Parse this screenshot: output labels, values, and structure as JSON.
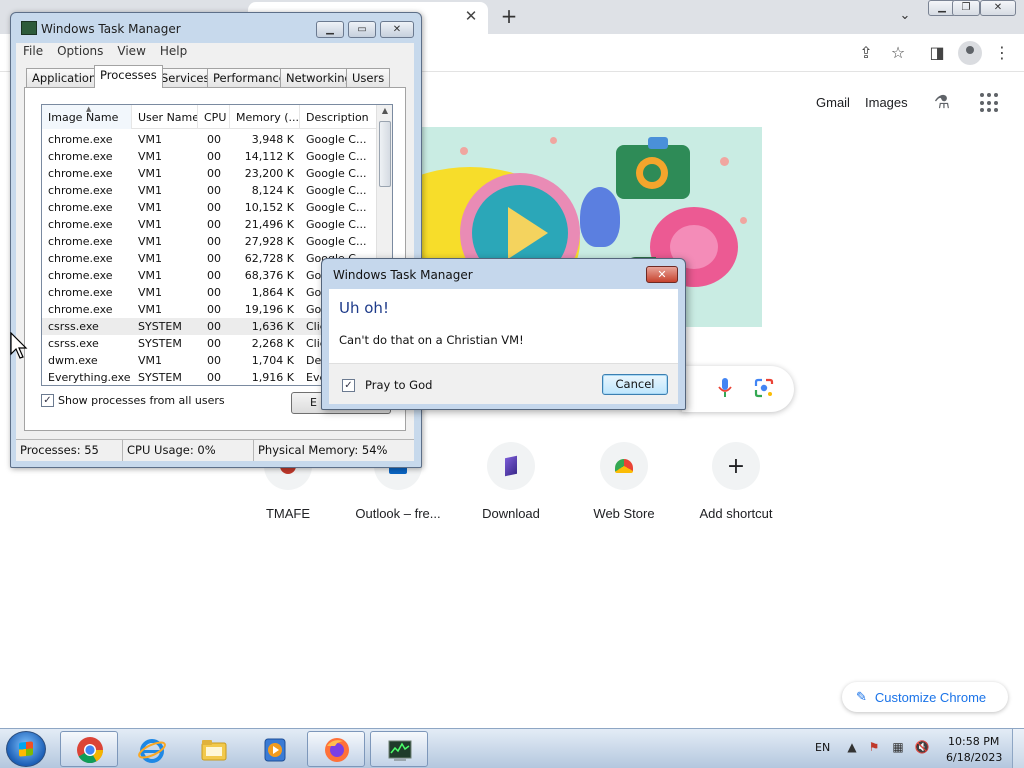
{
  "chrome": {
    "top_links": [
      "Gmail",
      "Images"
    ],
    "shortcuts": [
      {
        "label": "TMAFE",
        "icon": "tmafe-icon"
      },
      {
        "label": "Outlook – fre...",
        "icon": "outlook-icon"
      },
      {
        "label": "Download",
        "icon": "download-site-icon"
      },
      {
        "label": "Web Store",
        "icon": "chrome-web-store-icon"
      },
      {
        "label": "Add shortcut",
        "icon": "plus-icon"
      }
    ],
    "customize_label": "Customize Chrome",
    "accent": "#1a73e8"
  },
  "taskmgr": {
    "title": "Windows Task Manager",
    "menus": [
      "File",
      "Options",
      "View",
      "Help"
    ],
    "tabs": [
      "Applications",
      "Processes",
      "Services",
      "Performance",
      "Networking",
      "Users"
    ],
    "active_tab": "Processes",
    "columns": [
      "Image Name",
      "User Name",
      "CPU",
      "Memory (...",
      "Description"
    ],
    "rows": [
      {
        "name": "chrome.exe",
        "user": "VM1",
        "cpu": "00",
        "mem": "3,948 K",
        "desc": "Google C..."
      },
      {
        "name": "chrome.exe",
        "user": "VM1",
        "cpu": "00",
        "mem": "14,112 K",
        "desc": "Google C..."
      },
      {
        "name": "chrome.exe",
        "user": "VM1",
        "cpu": "00",
        "mem": "23,200 K",
        "desc": "Google C..."
      },
      {
        "name": "chrome.exe",
        "user": "VM1",
        "cpu": "00",
        "mem": "8,124 K",
        "desc": "Google C..."
      },
      {
        "name": "chrome.exe",
        "user": "VM1",
        "cpu": "00",
        "mem": "10,152 K",
        "desc": "Google C..."
      },
      {
        "name": "chrome.exe",
        "user": "VM1",
        "cpu": "00",
        "mem": "21,496 K",
        "desc": "Google C..."
      },
      {
        "name": "chrome.exe",
        "user": "VM1",
        "cpu": "00",
        "mem": "27,928 K",
        "desc": "Google C..."
      },
      {
        "name": "chrome.exe",
        "user": "VM1",
        "cpu": "00",
        "mem": "62,728 K",
        "desc": "Google C..."
      },
      {
        "name": "chrome.exe",
        "user": "VM1",
        "cpu": "00",
        "mem": "68,376 K",
        "desc": "Goo"
      },
      {
        "name": "chrome.exe",
        "user": "VM1",
        "cpu": "00",
        "mem": "1,864 K",
        "desc": "Goo"
      },
      {
        "name": "chrome.exe",
        "user": "VM1",
        "cpu": "00",
        "mem": "19,196 K",
        "desc": "Goo"
      },
      {
        "name": "csrss.exe",
        "user": "SYSTEM",
        "cpu": "00",
        "mem": "1,636 K",
        "desc": "Clie"
      },
      {
        "name": "csrss.exe",
        "user": "SYSTEM",
        "cpu": "00",
        "mem": "2,268 K",
        "desc": "Clie"
      },
      {
        "name": "dwm.exe",
        "user": "VM1",
        "cpu": "00",
        "mem": "1,704 K",
        "desc": "Des"
      },
      {
        "name": "Everything.exe",
        "user": "SYSTEM",
        "cpu": "00",
        "mem": "1,916 K",
        "desc": "Eve"
      }
    ],
    "selected_row": 11,
    "show_all_label": "Show processes from all users",
    "show_all_checked": true,
    "end_button_label": "E",
    "status": {
      "processes": "Processes: 55",
      "cpu": "CPU Usage: 0%",
      "memory": "Physical Memory: 54%"
    }
  },
  "dialog": {
    "title": "Windows Task Manager",
    "heading": "Uh oh!",
    "message": "Can't do that on a Christian VM!",
    "checkbox_label": "Pray to God",
    "checkbox_checked": true,
    "cancel_label": "Cancel",
    "heading_color": "#1e3b8a"
  },
  "taskbar": {
    "apps": [
      "chrome",
      "internet-explorer",
      "file-explorer",
      "media-player",
      "firefox",
      "task-manager"
    ],
    "language": "EN",
    "time": "10:58 PM",
    "date": "6/18/2023"
  }
}
